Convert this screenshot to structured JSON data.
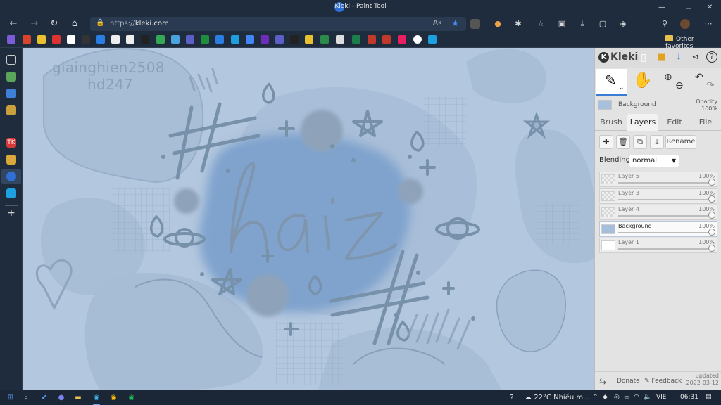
{
  "window": {
    "title": "Kleki - Paint Tool",
    "controls": [
      "—",
      "❐",
      "✕"
    ]
  },
  "browser": {
    "url_scheme": "https://",
    "url_host": "kleki.com",
    "favorites_label": "Other favorites"
  },
  "canvas": {
    "watermark_line1": "giainghien2508",
    "watermark_line2": "hd247",
    "background_color": "#b3c7de"
  },
  "kleki": {
    "logo": "Kleki",
    "current_layer_name": "Background",
    "opacity_label": "Opacity",
    "opacity_value": "100%",
    "tabs": {
      "brush": "Brush",
      "layers": "Layers",
      "edit": "Edit",
      "file": "File"
    },
    "rename_label": "Rename",
    "blending_label": "Blending",
    "blending_value": "normal",
    "layers": [
      {
        "name": "Layer 5",
        "opacity": "100%"
      },
      {
        "name": "Layer 3",
        "opacity": "100%"
      },
      {
        "name": "Layer 4",
        "opacity": "100%"
      },
      {
        "name": "Background",
        "opacity": "100%"
      },
      {
        "name": "Layer 1",
        "opacity": "100%"
      }
    ],
    "footer": {
      "donate": "Donate",
      "feedback": "Feedback",
      "updated_label": "updated",
      "updated_date": "2022-03-12"
    }
  },
  "taskbar": {
    "temperature": "22°C",
    "weather": "Nhiều m...",
    "language": "VIE",
    "time": "06:31"
  },
  "colors": {
    "accent": "#3a7bd5",
    "chrome": "#1f2c3d"
  }
}
